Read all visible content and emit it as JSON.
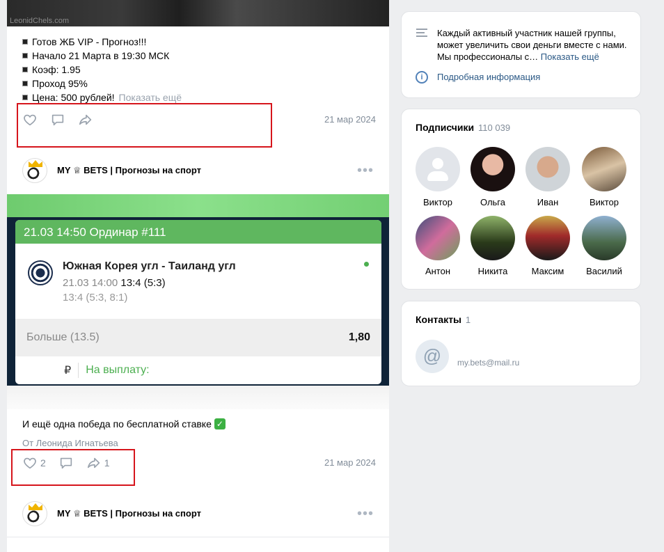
{
  "feed": {
    "top_watermark": "LeonidChels.com",
    "post1": {
      "lines": [
        "Готов ЖБ VIP - Прогноз!!!",
        "Начало 21 Марта в 19:30 МСК",
        "Коэф: 1.95",
        "Проход 95%",
        "Цена: 500 рублей!"
      ],
      "show_more": "Показать ещё",
      "date": "21 мар 2024"
    },
    "author_name": "MY ♕ BETS | Прогнозы на спорт",
    "more_dots": "•••",
    "bet_card": {
      "header": "21.03 14:50 Ординар  #111",
      "match_title": "Южная Корея угл - Таиланд угл",
      "match_time": "21.03 14:00",
      "match_score": "13:4 (5:3)",
      "match_sub": "13:4 (5:3, 8:1)",
      "odds_label": "Больше (13.5)",
      "odds_value": "1,80",
      "currency": "₽",
      "payout_label": "На выплату:"
    },
    "post2": {
      "text": "И ещё одна победа по бесплатной ставке",
      "check": "✓",
      "from": "От Леонида Игнатьева",
      "likes": "2",
      "shares": "1",
      "date": "21 мар 2024"
    }
  },
  "sidebar": {
    "about": {
      "description": "Каждый активный участник нашей группы, может увеличить свои деньги вместе с нами. Мы профессионалы с…",
      "show_more": "Показать ещё",
      "info_link": "Подробная информация",
      "info_glyph": "i"
    },
    "subscribers": {
      "title": "Подписчики",
      "count": "110 039",
      "people": [
        {
          "name": "Виктор"
        },
        {
          "name": "Ольга"
        },
        {
          "name": "Иван"
        },
        {
          "name": "Виктор"
        },
        {
          "name": "Антон"
        },
        {
          "name": "Никита"
        },
        {
          "name": "Максим"
        },
        {
          "name": "Василий"
        }
      ]
    },
    "contacts": {
      "title": "Контакты",
      "count": "1",
      "at_glyph": "@",
      "email": "my.bets@mail.ru"
    }
  },
  "colors": {
    "link": "#2a5885",
    "muted": "#818c99",
    "highlight_box": "#d6151c",
    "bet_green": "#5fb75f"
  }
}
